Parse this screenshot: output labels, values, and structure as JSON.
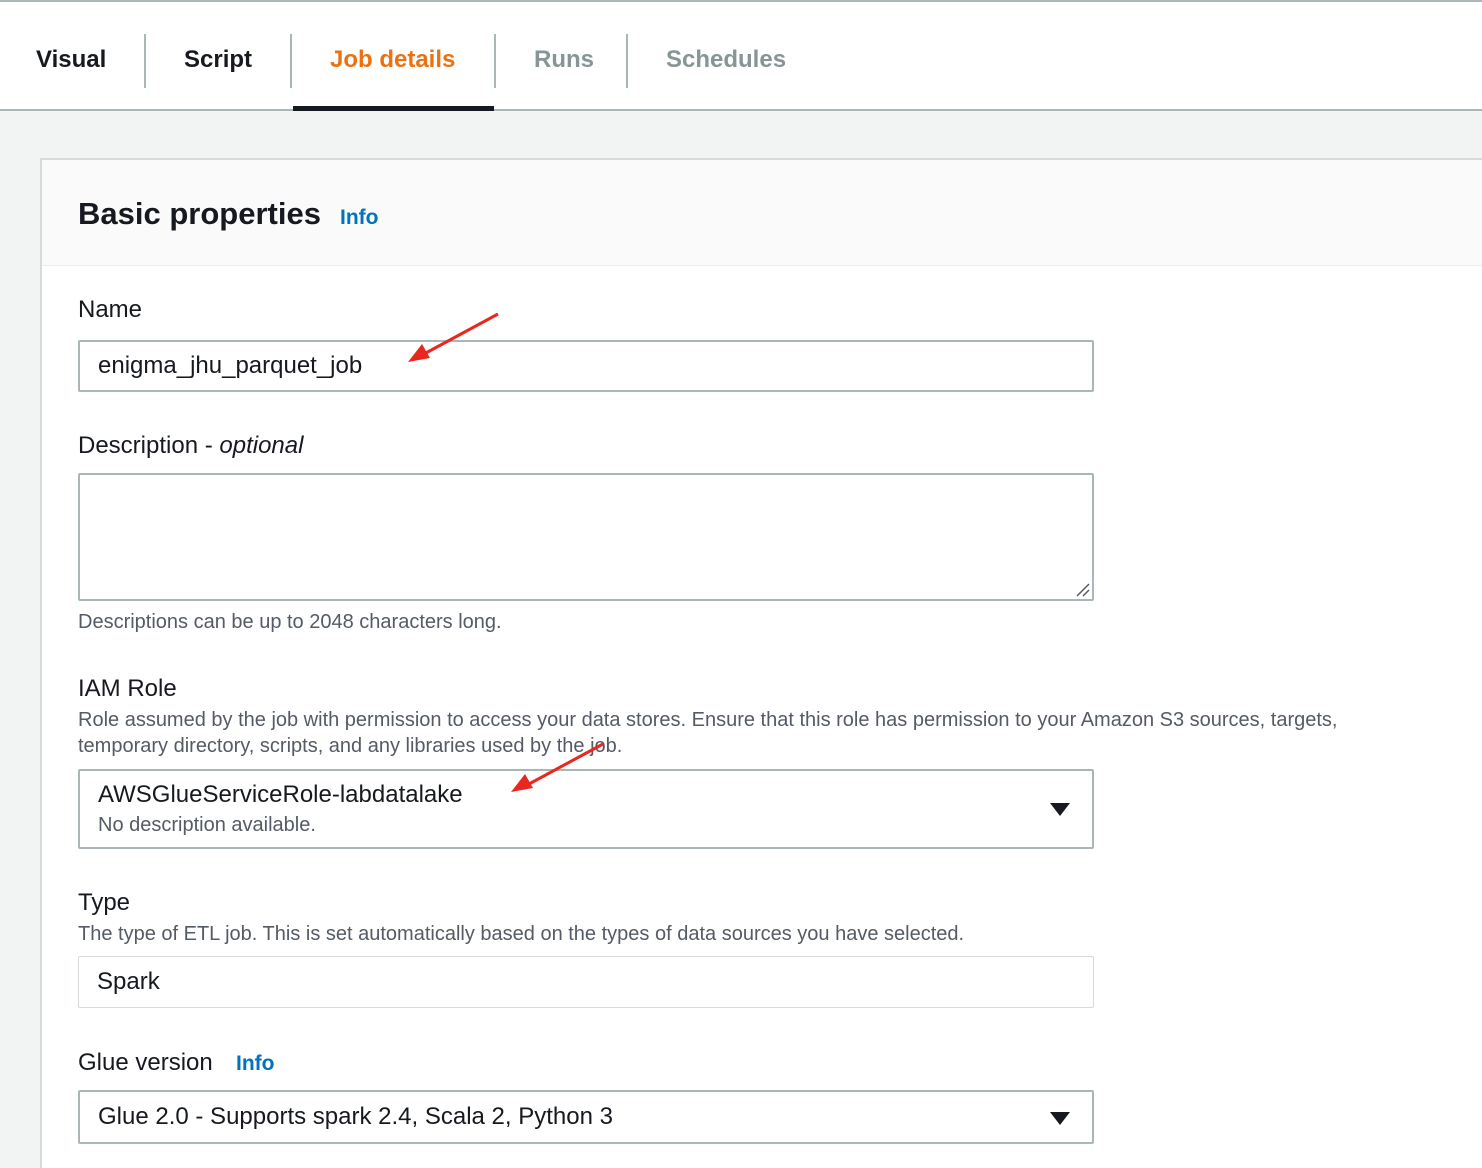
{
  "tabs": [
    {
      "label": "Visual",
      "state": "normal"
    },
    {
      "label": "Script",
      "state": "normal"
    },
    {
      "label": "Job details",
      "state": "active"
    },
    {
      "label": "Runs",
      "state": "disabled"
    },
    {
      "label": "Schedules",
      "state": "disabled"
    }
  ],
  "panel": {
    "title": "Basic properties",
    "info_label": "Info"
  },
  "name_field": {
    "label": "Name",
    "value": "enigma_jhu_parquet_job"
  },
  "description_field": {
    "label": "Description - ",
    "label_optional": "optional",
    "value": "",
    "help": "Descriptions can be up to 2048 characters long."
  },
  "iam_role": {
    "label": "IAM Role",
    "help": "Role assumed by the job with permission to access your data stores. Ensure that this role has permission to your Amazon S3 sources, targets, temporary directory, scripts, and any libraries used by the job.",
    "selected": "AWSGlueServiceRole-labdatalake",
    "selected_description": "No description available."
  },
  "type_field": {
    "label": "Type",
    "help": "The type of ETL job. This is set automatically based on the types of data sources you have selected.",
    "value": "Spark"
  },
  "glue_version": {
    "label": "Glue version",
    "info_label": "Info",
    "selected": "Glue 2.0 - Supports spark 2.4, Scala 2, Python 3"
  },
  "colors": {
    "accent": "#ec7211",
    "link": "#0073bb",
    "annotation_arrow": "#e8281e"
  },
  "icons": {
    "select_caret": "caret-down-icon",
    "textarea_grip": "resize-grip-icon",
    "annotation": "red-arrow-icon"
  }
}
